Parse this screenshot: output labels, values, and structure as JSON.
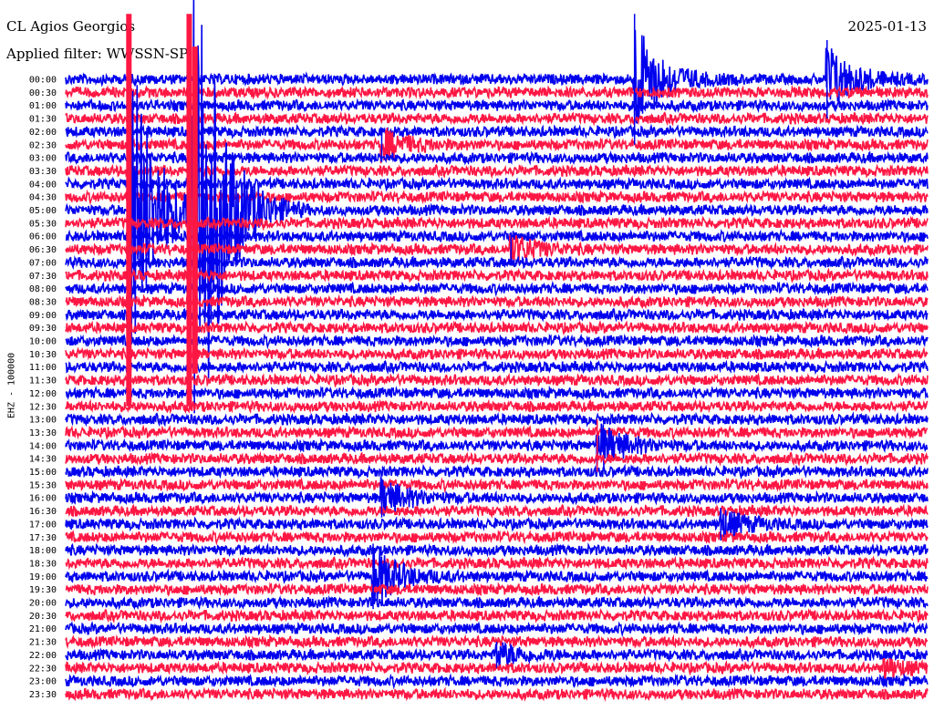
{
  "header": {
    "station": "CL Agios Georgios",
    "date": "2025-01-13",
    "filter": "Applied filter: WWSSN-SP"
  },
  "colors": {
    "trace_a": "#0000ee",
    "trace_b": "#ff1744",
    "background": "#ffffff"
  },
  "chart_data": {
    "type": "line",
    "title": "CL Agios Georgios",
    "ylabel": "EHZ - 100000",
    "row_labels": [
      "00:00",
      "00:30",
      "01:00",
      "01:30",
      "02:00",
      "02:30",
      "03:00",
      "03:30",
      "04:00",
      "04:30",
      "05:00",
      "05:30",
      "06:00",
      "06:30",
      "07:00",
      "07:30",
      "08:00",
      "08:30",
      "09:00",
      "09:30",
      "10:00",
      "10:30",
      "11:00",
      "11:30",
      "12:00",
      "12:30",
      "13:00",
      "13:30",
      "14:00",
      "14:30",
      "15:00",
      "15:30",
      "16:00",
      "16:30",
      "17:00",
      "17:30",
      "18:00",
      "18:30",
      "19:00",
      "19:30",
      "20:00",
      "20:30",
      "21:00",
      "21:30",
      "22:00",
      "22:30",
      "23:00",
      "23:30"
    ],
    "row_minutes": 30,
    "alternating_colors": [
      "#0000ee",
      "#ff1744"
    ],
    "events": [
      {
        "row": 0,
        "minute": 26.5,
        "amplitude": 6,
        "color": "#0000ee"
      },
      {
        "row": 0,
        "minute": 19.8,
        "amplitude": 10,
        "color": "#0000ee"
      },
      {
        "row": 5,
        "minute": 11.0,
        "amplitude": 2.5,
        "color": "#0000ee"
      },
      {
        "row": 10,
        "minute": 2.2,
        "amplitude": 30,
        "color": "#ff1744"
      },
      {
        "row": 10,
        "minute": 4.3,
        "amplitude": 30,
        "color": "#ff1744"
      },
      {
        "row": 10,
        "minute": 4.5,
        "amplitude": 25,
        "color": "#ff1744"
      },
      {
        "row": 13,
        "minute": 15.5,
        "amplitude": 2.5,
        "color": "#0000ee"
      },
      {
        "row": 28,
        "minute": 18.5,
        "amplitude": 4,
        "color": "#ff1744"
      },
      {
        "row": 32,
        "minute": 11.0,
        "amplitude": 3,
        "color": "#0000ee"
      },
      {
        "row": 34,
        "minute": 22.8,
        "amplitude": 2.5,
        "color": "#0000ee"
      },
      {
        "row": 38,
        "minute": 10.7,
        "amplitude": 5,
        "color": "#0000ee"
      },
      {
        "row": 44,
        "minute": 15.0,
        "amplitude": 2,
        "color": "#0000ee"
      },
      {
        "row": 45,
        "minute": 28.5,
        "amplitude": 1.5,
        "color": "#ff1744"
      }
    ]
  }
}
